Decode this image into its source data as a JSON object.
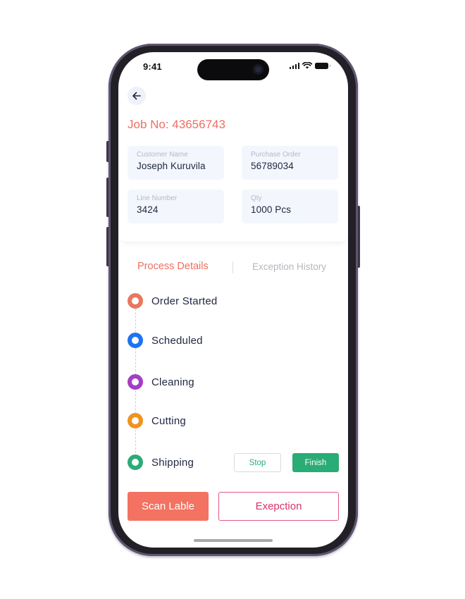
{
  "status_bar": {
    "time": "9:41"
  },
  "header": {
    "back_icon": "arrow-left-icon",
    "job_title": "Job No: 43656743"
  },
  "info": {
    "customer_name": {
      "label": "Customer Name",
      "value": "Joseph Kuruvila"
    },
    "purchase_order": {
      "label": "Purchase Order",
      "value": "56789034"
    },
    "line_number": {
      "label": "Line Number",
      "value": "3424"
    },
    "qty": {
      "label": "Qty",
      "value": "1000 Pcs"
    }
  },
  "tabs": [
    {
      "label": "Process Details",
      "active": true
    },
    {
      "label": "Exception History",
      "active": false
    }
  ],
  "process_steps": [
    {
      "label": "Order Started",
      "color": "#e8775f"
    },
    {
      "label": "Scheduled",
      "color": "#1f73f0"
    },
    {
      "label": "Cleaning",
      "color": "#a53ec4"
    },
    {
      "label": "Cutting",
      "color": "#f0931f"
    },
    {
      "label": "Shipping",
      "color": "#2aac76"
    }
  ],
  "step_actions": {
    "stop_label": "Stop",
    "finish_label": "Finish"
  },
  "footer": {
    "scan_label": "Scan Lable",
    "exception_label": "Exepction"
  },
  "colors": {
    "accent": "#ef6f5f",
    "success": "#2aac76",
    "exception": "#d6336c"
  }
}
